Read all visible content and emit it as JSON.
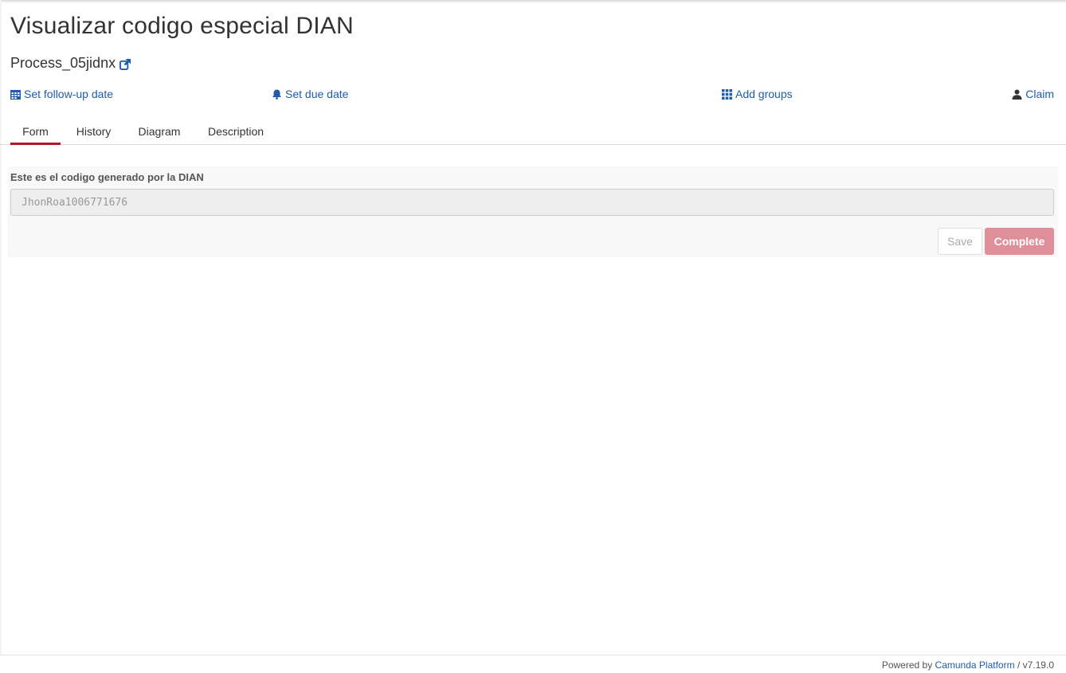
{
  "task": {
    "title": "Visualizar codigo especial DIAN",
    "process_name": "Process_05jidnx",
    "process_link_icon": "external-link-icon"
  },
  "actions": {
    "follow_up": {
      "label": "Set follow-up date",
      "icon": "calendar-icon"
    },
    "due_date": {
      "label": "Set due date",
      "icon": "bell-icon"
    },
    "groups": {
      "label": "Add groups",
      "icon": "grid-icon"
    },
    "claim": {
      "label": "Claim",
      "icon": "user-icon"
    }
  },
  "tabs": [
    {
      "label": "Form",
      "active": true
    },
    {
      "label": "History",
      "active": false
    },
    {
      "label": "Diagram",
      "active": false
    },
    {
      "label": "Description",
      "active": false
    }
  ],
  "form": {
    "field_label": "Este es el codigo generado por la DIAN",
    "field_value": "JhonRoa1006771676",
    "field_disabled": true,
    "save_label": "Save",
    "complete_label": "Complete"
  },
  "footer": {
    "prefix": "Powered by",
    "brand": "Camunda Platform",
    "separator": "/",
    "version": "v7.19.0"
  },
  "colors": {
    "link": "#1f5da8",
    "active_tab_underline": "#b5152b",
    "complete_button": "#de8f99"
  }
}
